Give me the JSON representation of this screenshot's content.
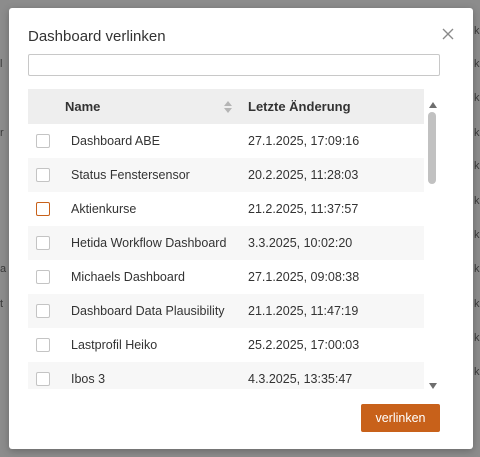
{
  "dialog": {
    "title": "Dashboard verlinken",
    "search": {
      "value": "",
      "placeholder": ""
    },
    "confirm_label": "verlinken"
  },
  "table": {
    "columns": [
      "Name",
      "Letzte Änderung"
    ],
    "rows": [
      {
        "name": "Dashboard ABE",
        "changed": "27.1.2025, 17:09:16",
        "checked": false
      },
      {
        "name": "Status Fenstersensor",
        "changed": "20.2.2025, 11:28:03",
        "checked": false
      },
      {
        "name": "Aktienkurse",
        "changed": "21.2.2025, 11:37:57",
        "checked": false
      },
      {
        "name": "Hetida Workflow Dashboard",
        "changed": "3.3.2025, 10:02:20",
        "checked": false
      },
      {
        "name": "Michaels Dashboard",
        "changed": "27.1.2025, 09:08:38",
        "checked": false
      },
      {
        "name": "Dashboard Data Plausibility",
        "changed": "21.1.2025, 11:47:19",
        "checked": false
      },
      {
        "name": "Lastprofil Heiko",
        "changed": "25.2.2025, 17:00:03",
        "checked": false
      },
      {
        "name": "Ibos 3",
        "changed": "4.3.2025, 13:35:47",
        "checked": false
      }
    ]
  },
  "colors": {
    "accent": "#c8611a",
    "header_bg": "#eeeeee",
    "overlay": "#8c8c8c"
  }
}
